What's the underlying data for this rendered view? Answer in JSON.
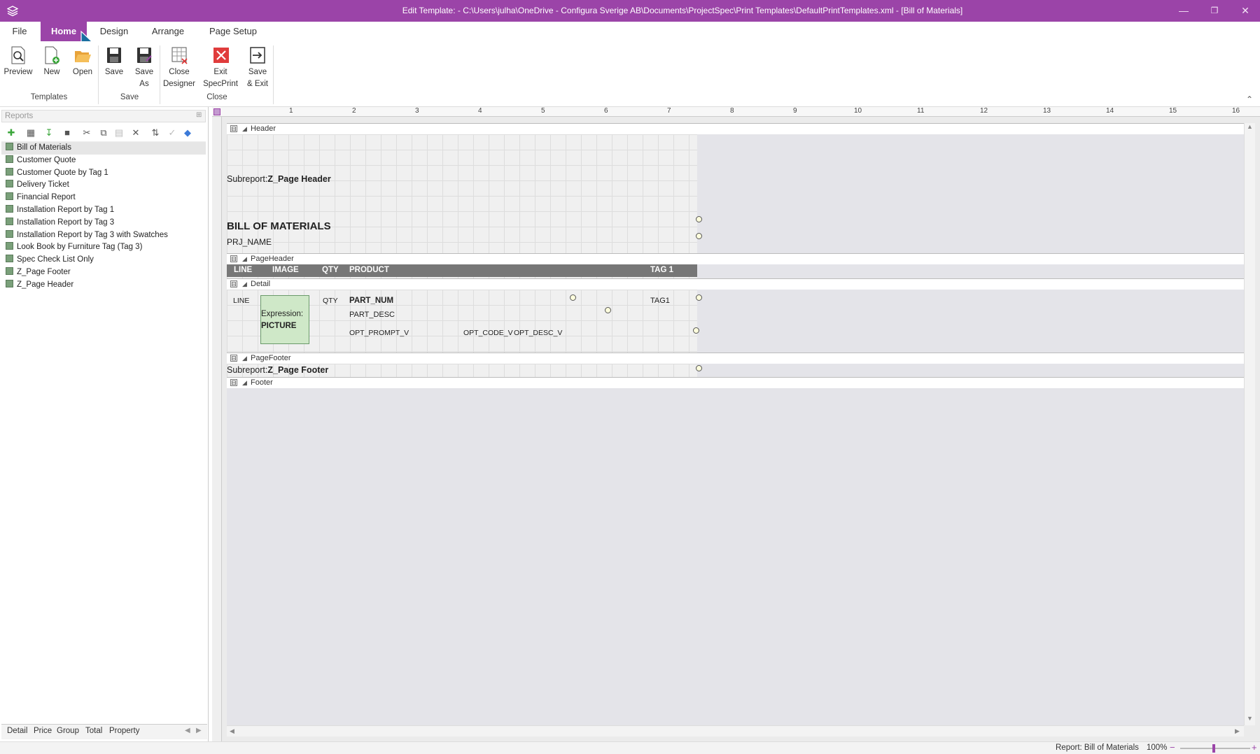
{
  "window": {
    "title": "Edit Template:  - C:\\Users\\julha\\OneDrive - Configura Sverige AB\\Documents\\ProjectSpec\\Print Templates\\DefaultPrintTemplates.xml - [Bill of Materials]"
  },
  "menu": {
    "tabs": [
      {
        "label": "File"
      },
      {
        "label": "Home"
      },
      {
        "label": "Design"
      },
      {
        "label": "Arrange"
      },
      {
        "label": "Page Setup"
      }
    ],
    "active": "Home"
  },
  "ribbon": {
    "preview": "Preview",
    "new": "New",
    "open": "Open",
    "save": "Save",
    "save_as_1": "Save",
    "save_as_2": "As",
    "close_designer_1": "Close",
    "close_designer_2": "Designer",
    "exit_1": "Exit",
    "exit_2": "SpecPrint",
    "save_exit_1": "Save",
    "save_exit_2": "& Exit",
    "groups": {
      "templates": "Templates",
      "save": "Save",
      "close": "Close"
    }
  },
  "reports_panel": {
    "title": "Reports",
    "items": [
      "Bill of Materials",
      "Customer Quote",
      "Customer Quote by Tag 1",
      "Delivery Ticket",
      "Financial Report",
      "Installation Report by Tag 1",
      "Installation Report by Tag 3",
      "Installation Report by Tag 3 with Swatches",
      "Look Book by Furniture Tag (Tag 3)",
      "Spec Check List Only",
      "Z_Page Footer",
      "Z_Page Header"
    ],
    "selected": "Bill of Materials",
    "bottom_tabs": [
      "Detail",
      "Price",
      "Group",
      "Total",
      "Property"
    ]
  },
  "ruler": {
    "numbers": [
      "1",
      "2",
      "3",
      "4",
      "5",
      "6",
      "7",
      "8",
      "9",
      "10",
      "11",
      "12",
      "13",
      "14",
      "15",
      "16"
    ]
  },
  "designer": {
    "bands": {
      "header": "Header",
      "page_header": "PageHeader",
      "detail": "Detail",
      "page_footer": "PageFooter",
      "footer": "Footer"
    },
    "header": {
      "subreport_prefix": "Subreport:",
      "subreport_name": "Z_Page Header",
      "title": "BILL OF MATERIALS",
      "prj_name": "PRJ_NAME"
    },
    "page_header_columns": [
      "LINE",
      "IMAGE",
      "QTY",
      "PRODUCT",
      "TAG 1"
    ],
    "detail": {
      "line": "LINE",
      "expression_label": "Expression:",
      "expression_value": "PICTURE",
      "qty": "QTY",
      "part_num": "PART_NUM",
      "part_desc": "PART_DESC",
      "tag1": "TAG1",
      "opt_prompt": "OPT_PROMPT_V",
      "opt_code": "OPT_CODE_V",
      "opt_desc": "OPT_DESC_V"
    },
    "page_footer": {
      "subreport_prefix": "Subreport:",
      "subreport_name": "Z_Page Footer"
    }
  },
  "status": {
    "report_label": "Report: Bill of Materials",
    "zoom": "100%"
  },
  "colors": {
    "accent": "#9b44a8",
    "header_band": "#777777"
  }
}
